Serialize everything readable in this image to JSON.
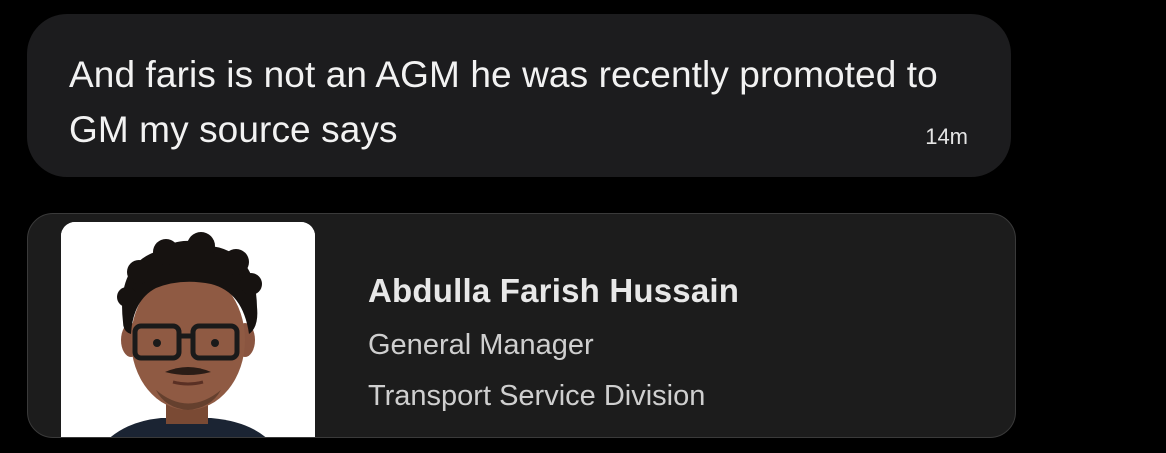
{
  "message": {
    "text": "And faris is not an AGM he was recently promoted to GM my source says",
    "timestamp": "14m"
  },
  "profile_card": {
    "name": "Abdulla Farish Hussain",
    "title": "General Manager",
    "division": "Transport Service Division",
    "photo_icon": "person-photo"
  },
  "colors": {
    "background": "#000000",
    "bubble": "#1c1c1e",
    "card": "#1c1c1c",
    "text": "#f2f2f2"
  }
}
